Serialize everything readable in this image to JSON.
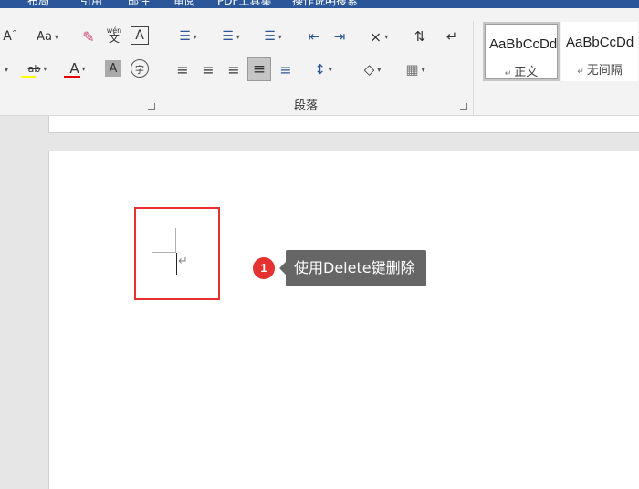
{
  "title_tabs": [
    "布局",
    "引用",
    "邮件",
    "审阅",
    "PDF工具集",
    "操作说明搜索"
  ],
  "font_group": {
    "row1": [
      {
        "name": "increase-font-size-button",
        "glyph": "A˄"
      },
      {
        "name": "change-case-button",
        "glyph": "Aa"
      },
      {
        "name": "clear-formatting-button",
        "glyph": "✐"
      },
      {
        "name": "phonetic-guide-button",
        "glyph": "文"
      },
      {
        "name": "character-border-button",
        "glyph": "A"
      }
    ],
    "row2": [
      {
        "name": "subscript-button",
        "glyph": "˅"
      },
      {
        "name": "text-highlight-button",
        "glyph": "ab"
      },
      {
        "name": "font-color-button",
        "glyph": "A"
      },
      {
        "name": "character-shading-button",
        "glyph": "A"
      },
      {
        "name": "enclose-characters-button",
        "glyph": "字"
      }
    ],
    "phonetic_top": "wén",
    "highlight_color": "#ffff00",
    "font_color": "#e00000"
  },
  "paragraph_group": {
    "label": "段落",
    "row1": [
      {
        "name": "bullets-button",
        "glyph": "☰"
      },
      {
        "name": "numbering-button",
        "glyph": "☰"
      },
      {
        "name": "multilevel-list-button",
        "glyph": "☰"
      },
      {
        "name": "decrease-indent-button",
        "glyph": "⇤"
      },
      {
        "name": "increase-indent-button",
        "glyph": "⇥"
      },
      {
        "name": "chinese-layout-button",
        "glyph": "⨯"
      },
      {
        "name": "sort-button",
        "glyph": "⇅"
      },
      {
        "name": "show-marks-button",
        "glyph": "↵"
      }
    ],
    "row2": [
      {
        "name": "align-left-button",
        "glyph": "≡"
      },
      {
        "name": "align-center-button",
        "glyph": "≡"
      },
      {
        "name": "align-right-button",
        "glyph": "≡"
      },
      {
        "name": "justify-button",
        "glyph": "≡"
      },
      {
        "name": "distributed-button",
        "glyph": "≡"
      },
      {
        "name": "line-spacing-button",
        "glyph": "↕"
      },
      {
        "name": "shading-button",
        "glyph": "◇"
      },
      {
        "name": "borders-button",
        "glyph": "▦"
      }
    ]
  },
  "styles": [
    {
      "sample": "AaBbCcDd",
      "name": "正文",
      "active": true
    },
    {
      "sample": "AaBbCcDd",
      "name": "无间隔",
      "active": false
    }
  ],
  "document": {
    "paragraph_mark": "↵"
  },
  "annotation": {
    "step": "1",
    "text": "使用Delete键删除",
    "box_color": "#e5312f"
  }
}
